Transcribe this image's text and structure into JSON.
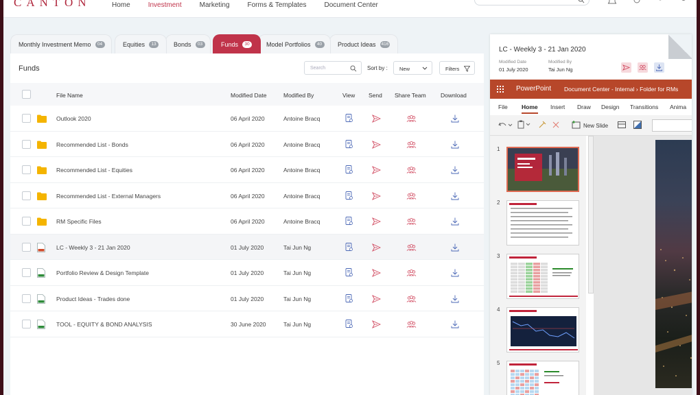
{
  "header": {
    "logo": "CANTON",
    "nav": [
      {
        "label": "Home",
        "active": false
      },
      {
        "label": "Investment",
        "active": true
      },
      {
        "label": "Marketing",
        "active": false
      },
      {
        "label": "Forms & Templates",
        "active": false
      },
      {
        "label": "Document Center",
        "active": false
      }
    ]
  },
  "tabs": [
    {
      "label": "Monthly Investment Memo",
      "count": "04",
      "active": false
    },
    {
      "label": "Equities",
      "count": "13",
      "active": false
    },
    {
      "label": "Bonds",
      "count": "03",
      "active": false
    },
    {
      "label": "Funds",
      "count": "30",
      "active": true
    },
    {
      "label": "Model Portfolios",
      "count": "40",
      "active": false
    },
    {
      "label": "Product Ideas",
      "count": "416",
      "active": false
    }
  ],
  "panel": {
    "title": "Funds",
    "search_placeholder": "Search",
    "sort_label": "Sort by :",
    "sort_value": "New",
    "filters_label": "Filters"
  },
  "table": {
    "columns": [
      "File Name",
      "Modified Date",
      "Modified By",
      "View",
      "Send",
      "Share Team",
      "Download"
    ],
    "rows": [
      {
        "type": "folder",
        "name": "Outlook 2020",
        "date": "06 April 2020",
        "by": "Antoine Bracq",
        "selected": false
      },
      {
        "type": "folder",
        "name": "Recommended List - Bonds",
        "date": "06 April 2020",
        "by": "Antoine Bracq",
        "selected": false
      },
      {
        "type": "folder",
        "name": "Recommended List - Equities",
        "date": "06 April 2020",
        "by": "Antoine Bracq",
        "selected": false
      },
      {
        "type": "folder",
        "name": "Recommended List - External Managers",
        "date": "06 April 2020",
        "by": "Antoine Bracq",
        "selected": false
      },
      {
        "type": "folder",
        "name": "RM Specific Files",
        "date": "06 April 2020",
        "by": "Antoine Bracq",
        "selected": false
      },
      {
        "type": "ppt",
        "name": "LC - Weekly 3 - 21 Jan 2020",
        "date": "01 July 2020",
        "by": "Tai Jun Ng",
        "selected": true
      },
      {
        "type": "xls",
        "name": "Portfolio Review & Design Template",
        "date": "01 July 2020",
        "by": "Tai Jun Ng",
        "selected": false
      },
      {
        "type": "xls",
        "name": "Product Ideas - Trades done",
        "date": "01 July 2020",
        "by": "Tai Jun Ng",
        "selected": false
      },
      {
        "type": "xls",
        "name": "TOOL - EQUITY & BOND ANALYSIS",
        "date": "30 June 2020",
        "by": "Tai Jun Ng",
        "selected": false
      }
    ]
  },
  "preview": {
    "title": "LC - Weekly 3 - 21 Jan 2020",
    "modified_date_label": "Modified Date",
    "modified_date": "01 July 2020",
    "modified_by_label": "Modified By",
    "modified_by": "Tai Jun Ng",
    "app_name": "PowerPoint",
    "path": "Document Center - Internal  ›  Folder for RMs",
    "ribbon_tabs": [
      "File",
      "Home",
      "Insert",
      "Draw",
      "Design",
      "Transitions",
      "Anima"
    ],
    "active_ribbon_tab": "Home",
    "new_slide_label": "New Slide",
    "slide_numbers": [
      "1",
      "2",
      "3",
      "4",
      "5"
    ]
  },
  "colors": {
    "accent": "#c0334a",
    "ppt_bar": "#b7472a",
    "folder": "#f4b400"
  }
}
